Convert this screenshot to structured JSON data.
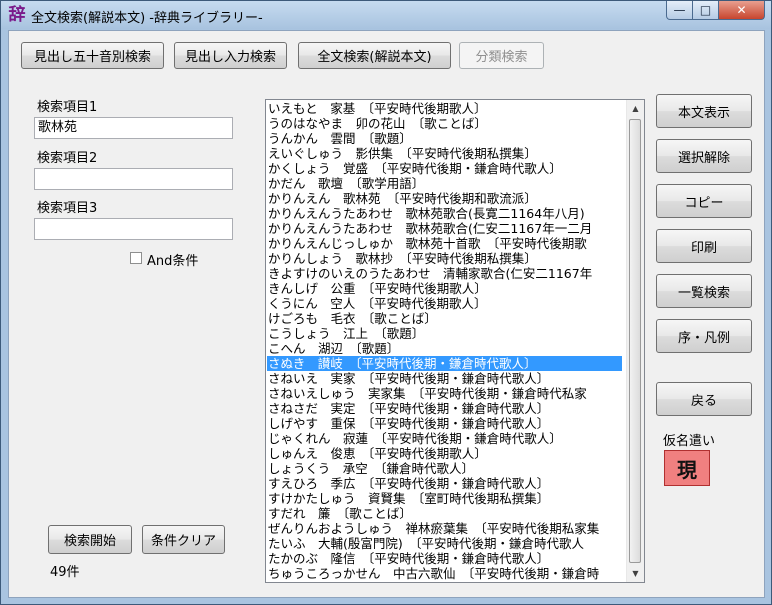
{
  "window": {
    "title": "全文検索(解説本文) -辞典ライブラリー-",
    "icon_char": "辞",
    "min_glyph": "—",
    "max_glyph": "□",
    "close_glyph": "✕"
  },
  "toolbar": {
    "btn_gojuon": "見出し五十音別検索",
    "btn_heading_input": "見出し入力検索",
    "btn_fulltext": "全文検索(解説本文)",
    "btn_category": "分類検索"
  },
  "search": {
    "field1_label": "検索項目1",
    "field1_value": "歌林苑",
    "field2_label": "検索項目2",
    "field2_value": "",
    "field3_label": "検索項目3",
    "field3_value": "",
    "and_label": "And条件",
    "start_button": "検索開始",
    "clear_button": "条件クリア",
    "result_count": "49件"
  },
  "results": {
    "selected_index": 17,
    "items": [
      "いえもと　家基　〔平安時代後期歌人〕",
      "うのはなやま　卯の花山　〔歌ことば〕",
      "うんかん　雲間　〔歌題〕",
      "えいぐしゅう　影供集　〔平安時代後期私撰集〕",
      "かくしょう　覚盛　〔平安時代後期・鎌倉時代歌人〕",
      "かだん　歌壇　〔歌学用語〕",
      "かりんえん　歌林苑　〔平安時代後期和歌流派〕",
      "かりんえんうたあわせ　歌林苑歌合(長寛二1164年八月)",
      "かりんえんうたあわせ　歌林苑歌合(仁安二1167年一二月",
      "かりんえんじっしゅか　歌林苑十首歌　〔平安時代後期歌",
      "かりんしょう　歌林抄　〔平安時代後期私撰集〕",
      "きよすけのいえのうたあわせ　清輔家歌合(仁安二1167年",
      "きんしげ　公重　〔平安時代後期歌人〕",
      "くうにん　空人　〔平安時代後期歌人〕",
      "けごろも　毛衣　〔歌ことば〕",
      "こうしょう　江上　〔歌題〕",
      "こへん　湖辺　〔歌題〕",
      "さぬき　讃岐　〔平安時代後期・鎌倉時代歌人〕",
      "さねいえ　実家　〔平安時代後期・鎌倉時代歌人〕",
      "さねいえしゅう　実家集　〔平安時代後期・鎌倉時代私家",
      "さねさだ　実定　〔平安時代後期・鎌倉時代歌人〕",
      "しげやす　重保　〔平安時代後期・鎌倉時代歌人〕",
      "じゃくれん　寂蓮　〔平安時代後期・鎌倉時代歌人〕",
      "しゅんえ　俊恵　〔平安時代後期歌人〕",
      "しょうくう　承空　〔鎌倉時代歌人〕",
      "すえひろ　季広　〔平安時代後期・鎌倉時代歌人〕",
      "すけかたしゅう　資賢集　〔室町時代後期私撰集〕",
      "すだれ　簾　〔歌ことば〕",
      "ぜんりんおようしゅう　禅林瘀葉集　〔平安時代後期私家集",
      "たいふ　大輔(殷富門院)　〔平安時代後期・鎌倉時代歌人",
      "たかのぶ　隆信　〔平安時代後期・鎌倉時代歌人〕",
      "ちゅうころっかせん　中古六歌仙　〔平安時代後期・鎌倉時"
    ],
    "scroll_up_glyph": "▲",
    "scroll_down_glyph": "▼"
  },
  "actions": {
    "show_text": "本文表示",
    "deselect": "選択解除",
    "copy": "コピー",
    "print": "印刷",
    "list_search": "一覧検索",
    "preface": "序・凡例",
    "back": "戻る"
  },
  "kana": {
    "label": "仮名遣い",
    "value": "現",
    "badge_color": "#f08080"
  }
}
